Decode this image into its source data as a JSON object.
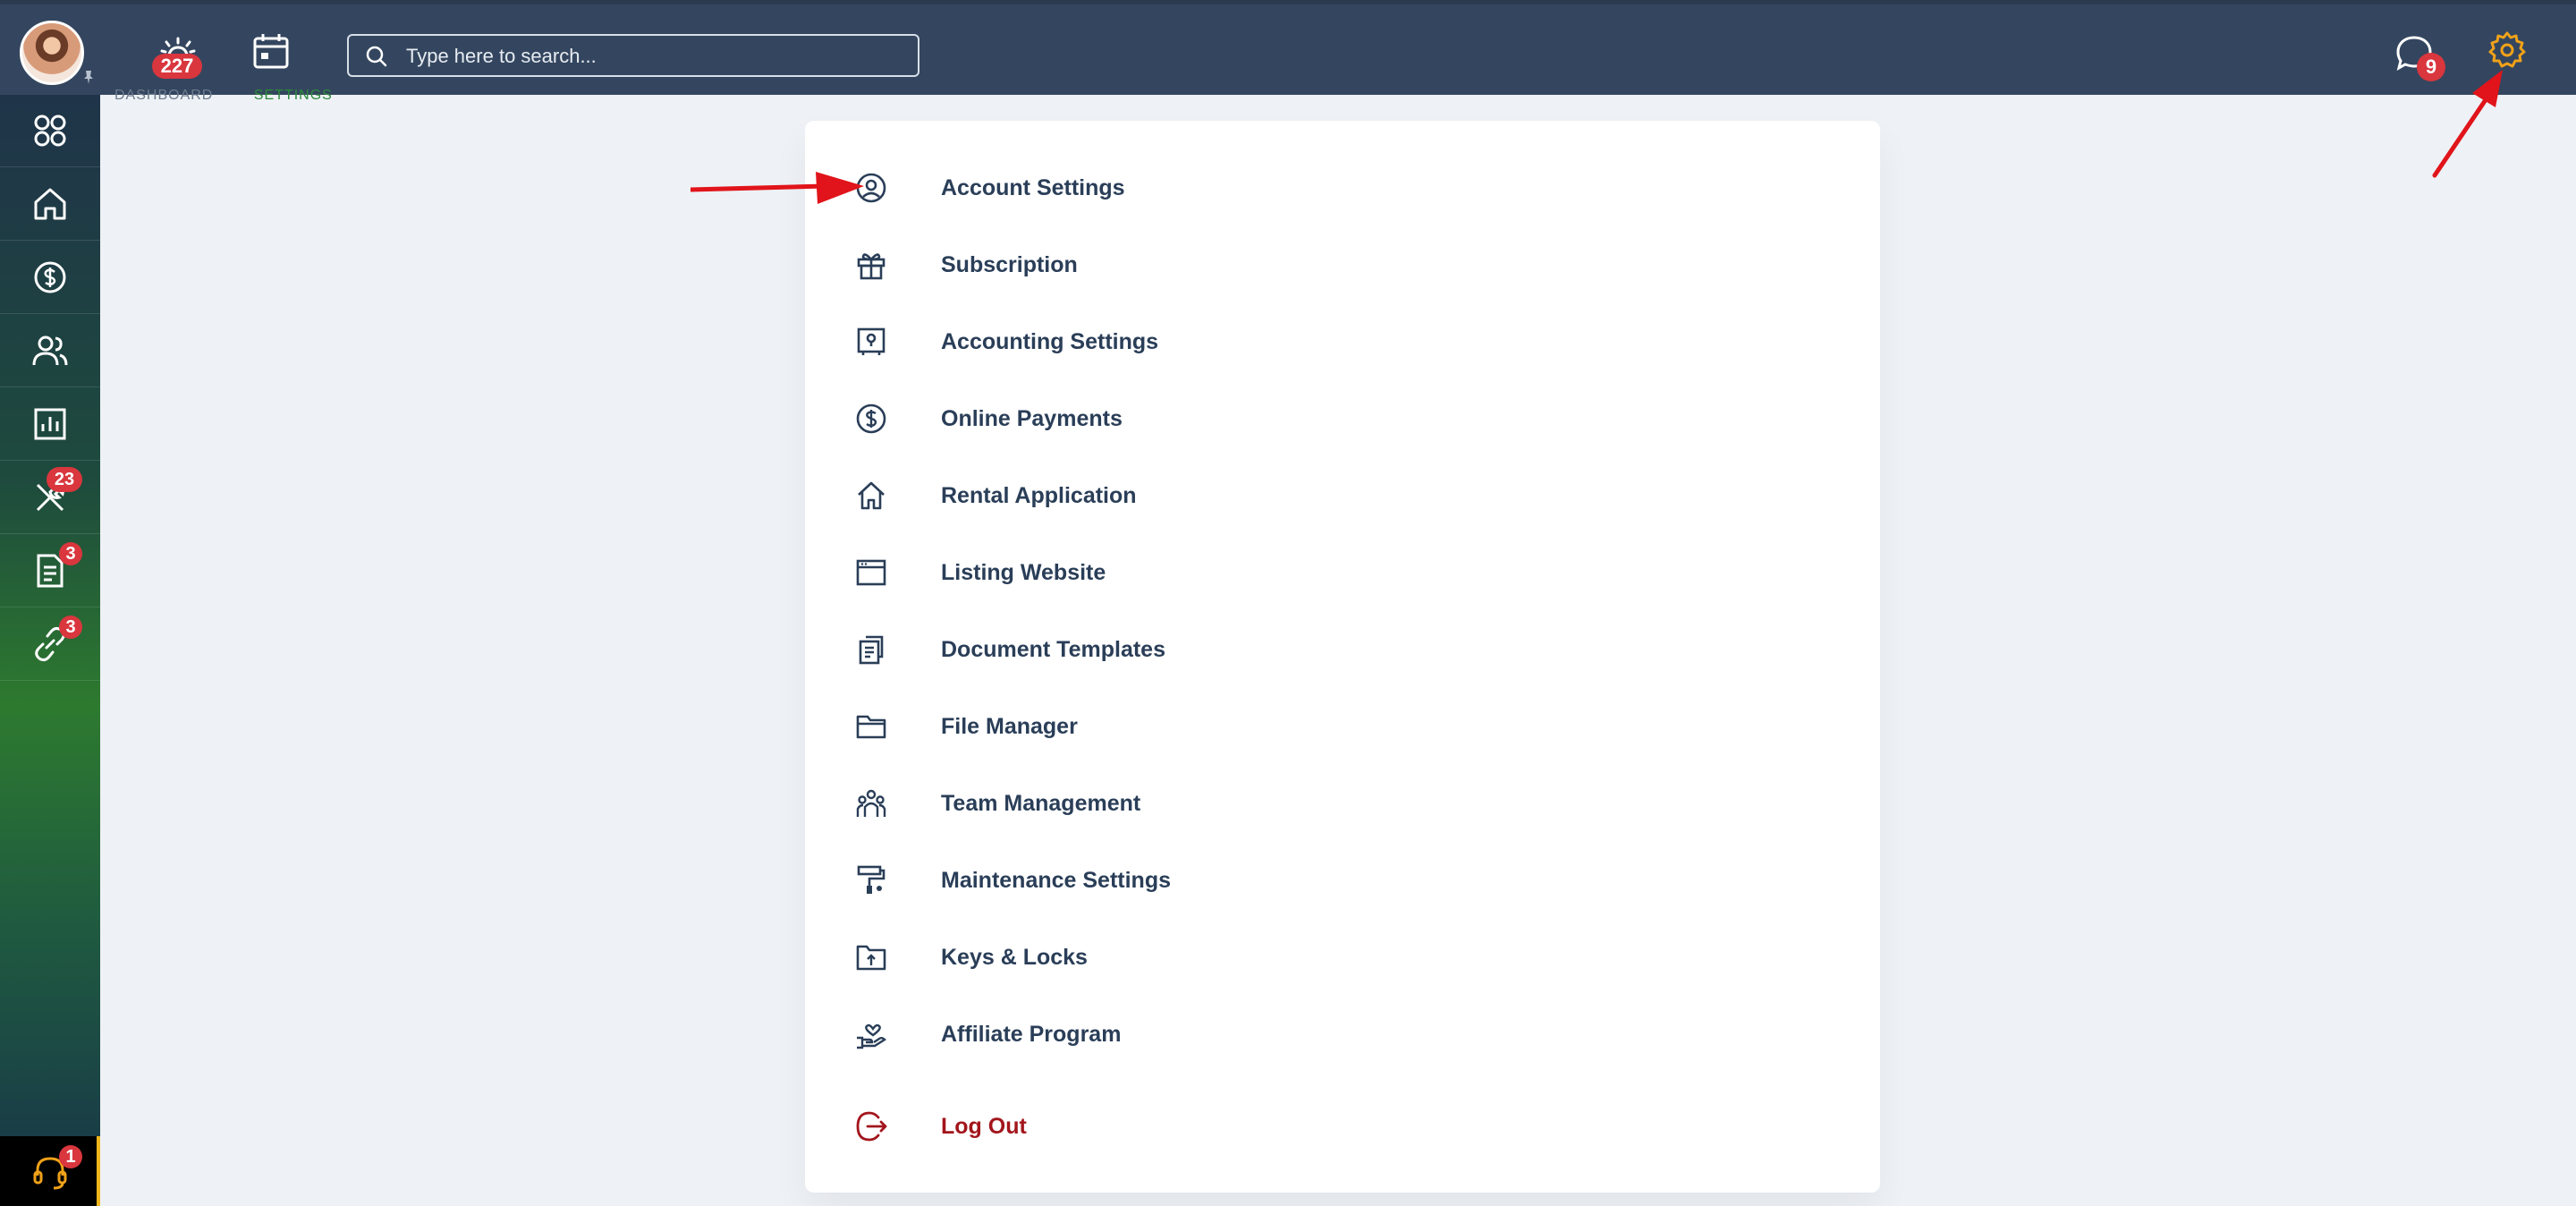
{
  "topbar": {
    "notifications_badge": "227",
    "chat_badge": "9",
    "search_placeholder": "Type here to search..."
  },
  "sidebar": {
    "items": [
      {
        "name": "apps",
        "icon": "grid-circles-icon",
        "badge": ""
      },
      {
        "name": "home",
        "icon": "home-icon",
        "badge": ""
      },
      {
        "name": "payments",
        "icon": "dollar-circle-icon",
        "badge": ""
      },
      {
        "name": "people",
        "icon": "users-icon",
        "badge": ""
      },
      {
        "name": "reports",
        "icon": "bar-chart-icon",
        "badge": ""
      },
      {
        "name": "maintenance",
        "icon": "tools-icon",
        "badge": "23"
      },
      {
        "name": "documents",
        "icon": "document-icon",
        "badge": "3"
      },
      {
        "name": "links",
        "icon": "link-icon",
        "badge": "3"
      }
    ],
    "support_badge": "1"
  },
  "breadcrumb": {
    "parent": "DASHBOARD",
    "current": "SETTINGS"
  },
  "settings_menu": {
    "items": [
      {
        "label": "Account Settings",
        "icon": "user-circle-icon"
      },
      {
        "label": "Subscription",
        "icon": "gift-icon"
      },
      {
        "label": "Accounting Settings",
        "icon": "safe-icon"
      },
      {
        "label": "Online Payments",
        "icon": "dollar-circle-icon"
      },
      {
        "label": "Rental Application",
        "icon": "house-icon"
      },
      {
        "label": "Listing Website",
        "icon": "browser-window-icon"
      },
      {
        "label": "Document Templates",
        "icon": "documents-icon"
      },
      {
        "label": "File Manager",
        "icon": "folder-icon"
      },
      {
        "label": "Team Management",
        "icon": "team-icon"
      },
      {
        "label": "Maintenance Settings",
        "icon": "paint-roller-icon"
      },
      {
        "label": "Keys & Locks",
        "icon": "key-folder-icon"
      },
      {
        "label": "Affiliate Program",
        "icon": "heart-hand-icon"
      }
    ],
    "logout_label": "Log Out"
  },
  "colors": {
    "topbar": "#34465f",
    "accent_gear": "#f0a219",
    "badge": "#d9363e",
    "menu_text": "#2a3e58",
    "logout_text": "#a3151c",
    "annotation_arrow": "#e0141a"
  }
}
